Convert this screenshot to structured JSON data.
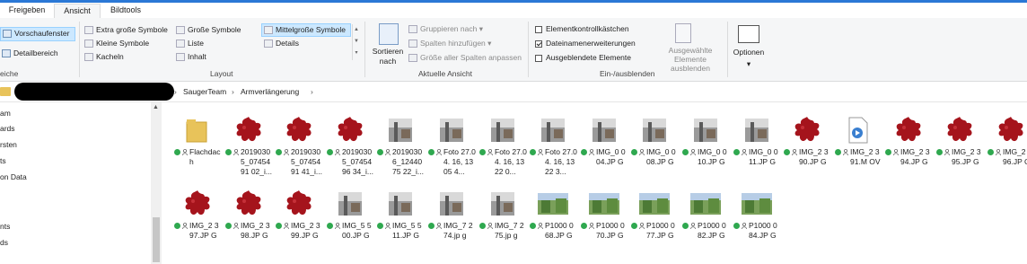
{
  "tabs": {
    "freigeben": "Freigeben",
    "ansicht": "Ansicht",
    "bildtools": "Bildtools"
  },
  "ribbon": {
    "bereiche": {
      "vorschaufenster": "Vorschaufenster",
      "detailbereich": "Detailbereich",
      "label_partial": "eiche"
    },
    "layout": {
      "extra_gross": "Extra große Symbole",
      "gross": "Große Symbole",
      "mittelgross": "Mittelgroße Symbole",
      "klein": "Kleine Symbole",
      "liste": "Liste",
      "details": "Details",
      "kacheln": "Kacheln",
      "inhalt": "Inhalt",
      "label": "Layout"
    },
    "aktuelle_ansicht": {
      "sortieren": "Sortieren nach",
      "gruppieren": "Gruppieren nach",
      "spalten": "Spalten hinzufügen",
      "groesse": "Größe aller Spalten anpassen",
      "label": "Aktuelle Ansicht"
    },
    "einausblenden": {
      "kontroll": "Elementkontrollkästchen",
      "erweiterungen": "Dateinamenerweiterungen",
      "ausgeblendet": "Ausgeblendete Elemente",
      "ausgewaehlte": "Ausgewählte Elemente ausblenden",
      "label": "Ein-/ausblenden"
    },
    "optionen": "Optionen"
  },
  "breadcrumb": {
    "folder1": "SaugerTeam",
    "folder2": "Armverlängerung"
  },
  "nav": {
    "items": [
      "am",
      "ards",
      "rsten",
      "ts",
      "on Data",
      "nts",
      "ds"
    ]
  },
  "files": {
    "row1": [
      {
        "name": "Flachdach",
        "type": "folder"
      },
      {
        "name": "20190305_0745491 02_i...",
        "type": "splat"
      },
      {
        "name": "20190305_0745491 41_i...",
        "type": "splat"
      },
      {
        "name": "20190305_0745496 34_i...",
        "type": "splat"
      },
      {
        "name": "20190306_1244075 22_i...",
        "type": "photo"
      },
      {
        "name": "Foto 27.04. 16, 13 05 4...",
        "type": "photo"
      },
      {
        "name": "Foto 27.04. 16, 13 22 0...",
        "type": "photo"
      },
      {
        "name": "Foto 27.04. 16, 13 22 3...",
        "type": "photo"
      },
      {
        "name": "IMG_0 004.JP G",
        "type": "photo"
      },
      {
        "name": "IMG_0 008.JP G",
        "type": "photo"
      },
      {
        "name": "IMG_0 010.JP G",
        "type": "photo"
      },
      {
        "name": "IMG_0 011.JP G",
        "type": "photo"
      },
      {
        "name": "IMG_2 390.JP G",
        "type": "splat"
      },
      {
        "name": "IMG_2 391.M OV",
        "type": "movie"
      },
      {
        "name": "IMG_2 394.JP G",
        "type": "splat"
      },
      {
        "name": "IMG_2 395.JP G",
        "type": "splat"
      },
      {
        "name": "IMG_2 396.JP G",
        "type": "splat"
      }
    ],
    "row2": [
      {
        "name": "IMG_2 397.JP G",
        "type": "splat"
      },
      {
        "name": "IMG_2 398.JP G",
        "type": "splat"
      },
      {
        "name": "IMG_2 399.JP G",
        "type": "splat"
      },
      {
        "name": "IMG_5 500.JP G",
        "type": "photo"
      },
      {
        "name": "IMG_5 511.JP G",
        "type": "photo"
      },
      {
        "name": "IMG_7 274.jp g",
        "type": "photo"
      },
      {
        "name": "IMG_7 275.jp g",
        "type": "photo"
      },
      {
        "name": "P1000 068.JP G",
        "type": "green"
      },
      {
        "name": "P1000 070.JP G",
        "type": "green"
      },
      {
        "name": "P1000 077.JP G",
        "type": "green"
      },
      {
        "name": "P1000 082.JP G",
        "type": "green"
      },
      {
        "name": "P1000 084.JP G",
        "type": "green"
      }
    ]
  }
}
